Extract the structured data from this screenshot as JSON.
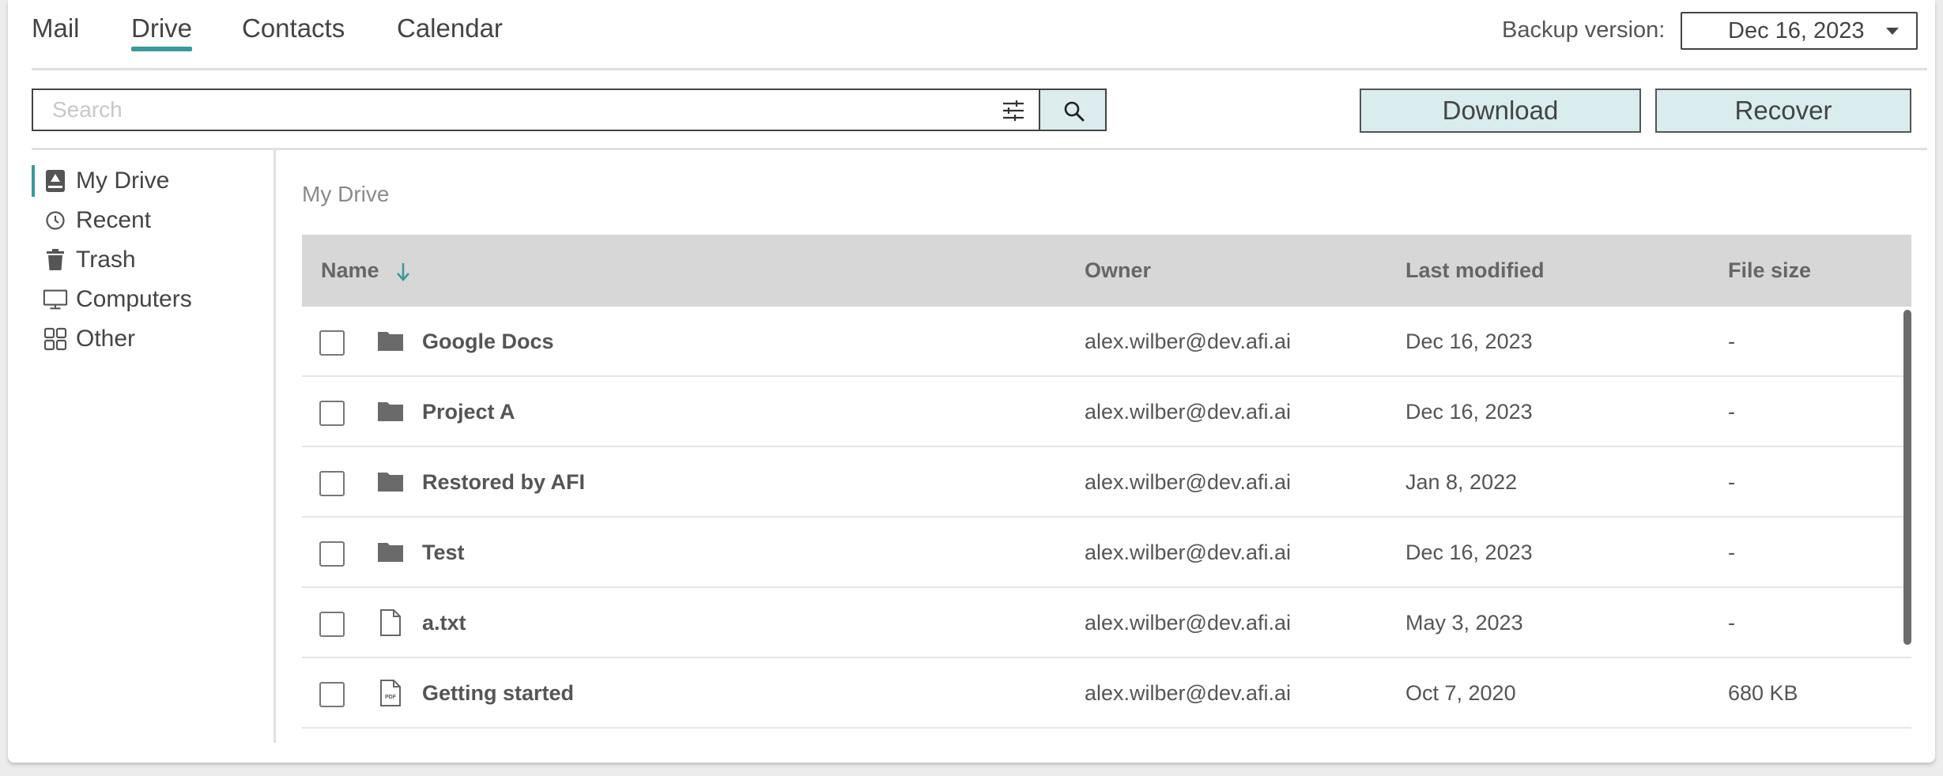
{
  "tabs": [
    {
      "label": "Mail"
    },
    {
      "label": "Drive"
    },
    {
      "label": "Contacts"
    },
    {
      "label": "Calendar"
    }
  ],
  "active_tab": "Drive",
  "backup": {
    "label": "Backup version:",
    "value": "Dec 16, 2023"
  },
  "search": {
    "placeholder": "Search"
  },
  "actions": {
    "download": "Download",
    "recover": "Recover"
  },
  "sidebar": {
    "items": [
      {
        "label": "My Drive",
        "icon": "drive-icon"
      },
      {
        "label": "Recent",
        "icon": "clock-icon"
      },
      {
        "label": "Trash",
        "icon": "trash-icon"
      },
      {
        "label": "Computers",
        "icon": "monitor-icon"
      },
      {
        "label": "Other",
        "icon": "grid-icon"
      }
    ]
  },
  "breadcrumb": "My Drive",
  "table": {
    "columns": {
      "name": "Name",
      "owner": "Owner",
      "modified": "Last modified",
      "size": "File size"
    },
    "sort": {
      "column": "Name",
      "direction": "descending"
    },
    "rows": [
      {
        "name": "Google Docs",
        "type": "folder",
        "owner": "alex.wilber@dev.afi.ai",
        "modified": "Dec 16, 2023",
        "size": "-"
      },
      {
        "name": "Project A",
        "type": "folder",
        "owner": "alex.wilber@dev.afi.ai",
        "modified": "Dec 16, 2023",
        "size": "-"
      },
      {
        "name": "Restored by AFI",
        "type": "folder",
        "owner": "alex.wilber@dev.afi.ai",
        "modified": "Jan 8, 2022",
        "size": "-"
      },
      {
        "name": "Test",
        "type": "folder",
        "owner": "alex.wilber@dev.afi.ai",
        "modified": "Dec 16, 2023",
        "size": "-"
      },
      {
        "name": "a.txt",
        "type": "file",
        "owner": "alex.wilber@dev.afi.ai",
        "modified": "May 3, 2023",
        "size": "-"
      },
      {
        "name": "Getting started",
        "type": "pdf",
        "pdf_label": "PDF",
        "owner": "alex.wilber@dev.afi.ai",
        "modified": "Oct 7, 2020",
        "size": "680 KB"
      }
    ]
  },
  "colors": {
    "accent": "#3a9a9a",
    "button_bg": "#d9ecee",
    "header_bg": "#d7d7d7"
  }
}
